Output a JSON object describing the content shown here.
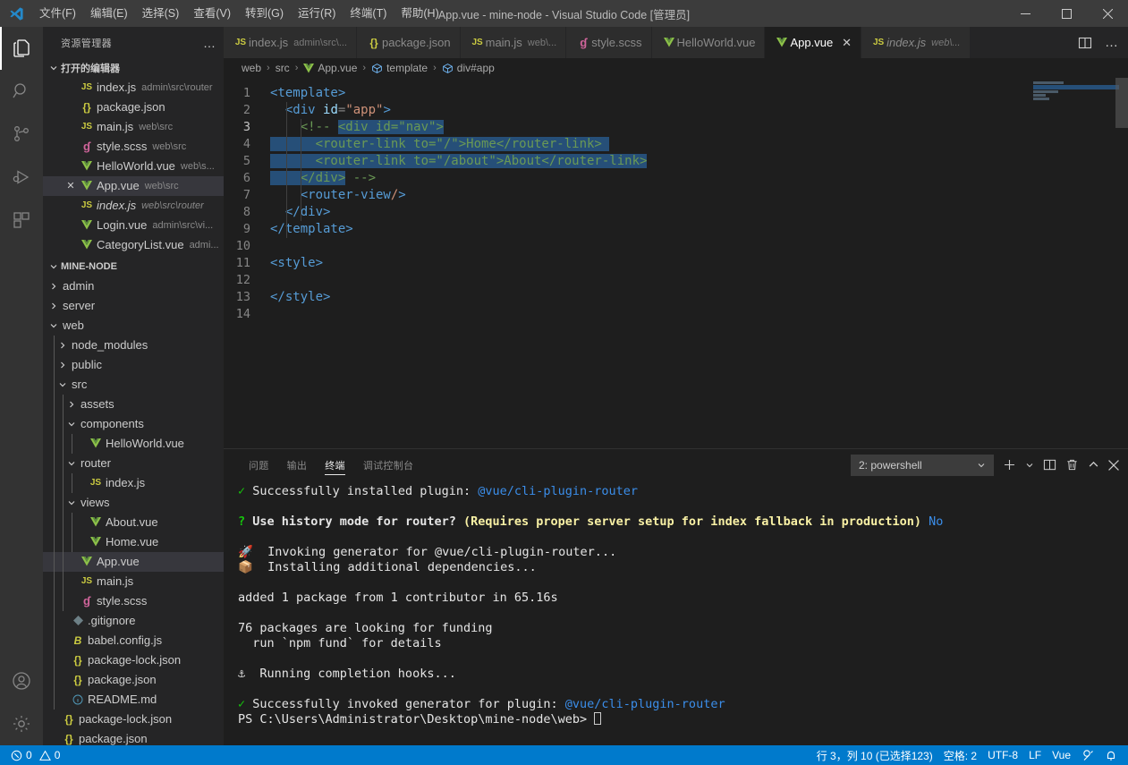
{
  "titlebar": {
    "title": "App.vue - mine-node - Visual Studio Code [管理员]",
    "menus": [
      "文件(F)",
      "编辑(E)",
      "选择(S)",
      "查看(V)",
      "转到(G)",
      "运行(R)",
      "终端(T)",
      "帮助(H)"
    ],
    "minimize": "minimize-icon",
    "maximize": "maximize-icon",
    "close": "close-icon"
  },
  "activitybar": {
    "items": [
      {
        "name": "explorer",
        "icon": "files-icon",
        "active": true
      },
      {
        "name": "search",
        "icon": "search-icon",
        "active": false
      },
      {
        "name": "source-control",
        "icon": "source-control-icon",
        "active": false
      },
      {
        "name": "run-debug",
        "icon": "run-debug-icon",
        "active": false
      },
      {
        "name": "extensions",
        "icon": "extensions-icon",
        "active": false
      }
    ],
    "bottom": [
      {
        "name": "accounts",
        "icon": "account-icon"
      },
      {
        "name": "manage",
        "icon": "gear-icon"
      }
    ]
  },
  "sidebar": {
    "title": "资源管理器",
    "more": "…",
    "open_editors": {
      "label": "打开的编辑器",
      "items": [
        {
          "icon": "js",
          "name": "index.js",
          "path": "admin\\src\\router",
          "active": false,
          "italic": false
        },
        {
          "icon": "json",
          "name": "package.json",
          "path": "",
          "active": false,
          "italic": false
        },
        {
          "icon": "js",
          "name": "main.js",
          "path": "web\\src",
          "active": false,
          "italic": false
        },
        {
          "icon": "scss",
          "name": "style.scss",
          "path": "web\\src",
          "active": false,
          "italic": false
        },
        {
          "icon": "vue",
          "name": "HelloWorld.vue",
          "path": "web\\s...",
          "active": false,
          "italic": false
        },
        {
          "icon": "vue",
          "name": "App.vue",
          "path": "web\\src",
          "active": true,
          "italic": false
        },
        {
          "icon": "js",
          "name": "index.js",
          "path": "web\\src\\router",
          "active": false,
          "italic": true
        },
        {
          "icon": "vue",
          "name": "Login.vue",
          "path": "admin\\src\\vi...",
          "active": false,
          "italic": false
        },
        {
          "icon": "vue",
          "name": "CategoryList.vue",
          "path": "admi...",
          "active": false,
          "italic": false
        }
      ]
    },
    "project": {
      "label": "MINE-NODE",
      "items": [
        {
          "depth": 1,
          "kind": "folder",
          "expanded": false,
          "name": "admin",
          "icon": ""
        },
        {
          "depth": 1,
          "kind": "folder",
          "expanded": false,
          "name": "server",
          "icon": ""
        },
        {
          "depth": 1,
          "kind": "folder",
          "expanded": true,
          "name": "web",
          "icon": ""
        },
        {
          "depth": 2,
          "kind": "folder",
          "expanded": false,
          "name": "node_modules",
          "icon": ""
        },
        {
          "depth": 2,
          "kind": "folder",
          "expanded": false,
          "name": "public",
          "icon": ""
        },
        {
          "depth": 2,
          "kind": "folder",
          "expanded": true,
          "name": "src",
          "icon": ""
        },
        {
          "depth": 3,
          "kind": "folder",
          "expanded": false,
          "name": "assets",
          "icon": ""
        },
        {
          "depth": 3,
          "kind": "folder",
          "expanded": true,
          "name": "components",
          "icon": ""
        },
        {
          "depth": 4,
          "kind": "file",
          "expanded": false,
          "name": "HelloWorld.vue",
          "icon": "vue"
        },
        {
          "depth": 3,
          "kind": "folder",
          "expanded": true,
          "name": "router",
          "icon": ""
        },
        {
          "depth": 4,
          "kind": "file",
          "expanded": false,
          "name": "index.js",
          "icon": "js"
        },
        {
          "depth": 3,
          "kind": "folder",
          "expanded": true,
          "name": "views",
          "icon": ""
        },
        {
          "depth": 4,
          "kind": "file",
          "expanded": false,
          "name": "About.vue",
          "icon": "vue"
        },
        {
          "depth": 4,
          "kind": "file",
          "expanded": false,
          "name": "Home.vue",
          "icon": "vue"
        },
        {
          "depth": 3,
          "kind": "file",
          "expanded": false,
          "name": "App.vue",
          "icon": "vue",
          "selected": true
        },
        {
          "depth": 3,
          "kind": "file",
          "expanded": false,
          "name": "main.js",
          "icon": "js"
        },
        {
          "depth": 3,
          "kind": "file",
          "expanded": false,
          "name": "style.scss",
          "icon": "scss"
        },
        {
          "depth": 2,
          "kind": "file",
          "expanded": false,
          "name": ".gitignore",
          "icon": "git"
        },
        {
          "depth": 2,
          "kind": "file",
          "expanded": false,
          "name": "babel.config.js",
          "icon": "babel"
        },
        {
          "depth": 2,
          "kind": "file",
          "expanded": false,
          "name": "package-lock.json",
          "icon": "json"
        },
        {
          "depth": 2,
          "kind": "file",
          "expanded": false,
          "name": "package.json",
          "icon": "json"
        },
        {
          "depth": 2,
          "kind": "file",
          "expanded": false,
          "name": "README.md",
          "icon": "md"
        },
        {
          "depth": 1,
          "kind": "file",
          "expanded": false,
          "name": "package-lock.json",
          "icon": "json"
        },
        {
          "depth": 1,
          "kind": "file",
          "expanded": false,
          "name": "package.json",
          "icon": "json"
        }
      ]
    }
  },
  "tabs": [
    {
      "icon": "js",
      "name": "index.js",
      "path": "admin\\src\\...",
      "active": false,
      "italic": false
    },
    {
      "icon": "json",
      "name": "package.json",
      "path": "",
      "active": false,
      "italic": false
    },
    {
      "icon": "js",
      "name": "main.js",
      "path": "web\\...",
      "active": false,
      "italic": false
    },
    {
      "icon": "scss",
      "name": "style.scss",
      "path": "",
      "active": false,
      "italic": false
    },
    {
      "icon": "vue",
      "name": "HelloWorld.vue",
      "path": "",
      "active": false,
      "italic": false
    },
    {
      "icon": "vue",
      "name": "App.vue",
      "path": "",
      "active": true,
      "italic": false,
      "close": "✕"
    },
    {
      "icon": "js",
      "name": "index.js",
      "path": "web\\...",
      "active": false,
      "italic": true
    }
  ],
  "tab_actions": {
    "split": "split-editor-icon",
    "more": "more-actions-icon"
  },
  "breadcrumb": [
    {
      "label": "web",
      "icon": ""
    },
    {
      "label": "src",
      "icon": ""
    },
    {
      "label": "App.vue",
      "icon": "vue"
    },
    {
      "label": "template",
      "icon": "symbol"
    },
    {
      "label": "div#app",
      "icon": "symbol"
    }
  ],
  "editor": {
    "language": "Vue",
    "lines": [
      {
        "n": "1",
        "segments": [
          {
            "t": "<template>",
            "c": "tk-tag"
          }
        ]
      },
      {
        "n": "2",
        "segments": [
          {
            "t": "  <div ",
            "c": "tk-tag"
          },
          {
            "t": "id",
            "c": "tk-attr"
          },
          {
            "t": "=",
            "c": "tk-punc"
          },
          {
            "t": "\"app\"",
            "c": "tk-str"
          },
          {
            "t": ">",
            "c": "tk-tag"
          }
        ]
      },
      {
        "n": "3",
        "segments": [
          {
            "t": "    <!-- ",
            "c": "tk-comment"
          },
          {
            "t": "<div id=\"nav\">",
            "c": "tk-comment sel"
          }
        ]
      },
      {
        "n": "4",
        "segments": [
          {
            "t": "      <router-link to=\"/\">Home</router-link> ",
            "c": "tk-comment sel"
          }
        ]
      },
      {
        "n": "5",
        "segments": [
          {
            "t": "      <router-link to=\"/about\">About</router-link>",
            "c": "tk-comment sel"
          }
        ]
      },
      {
        "n": "6",
        "segments": [
          {
            "t": "    </div>",
            "c": "tk-comment sel"
          },
          {
            "t": " -->",
            "c": "tk-comment"
          }
        ]
      },
      {
        "n": "7",
        "segments": [
          {
            "t": "    <router-view",
            "c": "tk-tag"
          },
          {
            "t": "/",
            "c": "tk-str"
          },
          {
            "t": ">",
            "c": "tk-tag"
          }
        ]
      },
      {
        "n": "8",
        "segments": [
          {
            "t": "  </div>",
            "c": "tk-tag"
          }
        ]
      },
      {
        "n": "9",
        "segments": [
          {
            "t": "</template>",
            "c": "tk-tag"
          }
        ]
      },
      {
        "n": "10",
        "segments": []
      },
      {
        "n": "11",
        "segments": [
          {
            "t": "<style>",
            "c": "tk-tag"
          }
        ]
      },
      {
        "n": "12",
        "segments": []
      },
      {
        "n": "13",
        "segments": [
          {
            "t": "</style>",
            "c": "tk-tag"
          }
        ]
      },
      {
        "n": "14",
        "segments": []
      }
    ]
  },
  "panel": {
    "tabs": [
      {
        "label": "问题",
        "active": false
      },
      {
        "label": "输出",
        "active": false
      },
      {
        "label": "终端",
        "active": true
      },
      {
        "label": "调试控制台",
        "active": false
      }
    ],
    "terminal_select": "2: powershell",
    "actions": [
      "new-terminal-icon",
      "chevron-down-icon",
      "split-terminal-icon",
      "trash-icon",
      "maximize-panel-icon",
      "close-panel-icon"
    ],
    "output": [
      [
        {
          "t": "✓ ",
          "c": "t-green"
        },
        {
          "t": "Successfully installed plugin: ",
          "c": "t-white"
        },
        {
          "t": "@vue/cli-plugin-router",
          "c": "t-cyan"
        }
      ],
      [],
      [
        {
          "t": "? ",
          "c": "t-green t-bold"
        },
        {
          "t": "Use history mode for router? ",
          "c": "t-white t-bold"
        },
        {
          "t": "(Requires proper server setup for index fallback in production) ",
          "c": "t-yellow t-bold"
        },
        {
          "t": "No",
          "c": "t-cyan"
        }
      ],
      [],
      [
        {
          "t": "🚀  Invoking generator for @vue/cli-plugin-router...",
          "c": "t-white"
        }
      ],
      [
        {
          "t": "📦  Installing additional dependencies...",
          "c": "t-white"
        }
      ],
      [],
      [
        {
          "t": "added 1 package from 1 contributor in 65.16s",
          "c": "t-white"
        }
      ],
      [],
      [
        {
          "t": "76 packages are looking for funding",
          "c": "t-white"
        }
      ],
      [
        {
          "t": "  run `npm fund` for details",
          "c": "t-white"
        }
      ],
      [],
      [
        {
          "t": "⚓  Running completion hooks...",
          "c": "t-white"
        }
      ],
      [],
      [
        {
          "t": "✓ ",
          "c": "t-green"
        },
        {
          "t": "Successfully invoked generator for plugin: ",
          "c": "t-white"
        },
        {
          "t": "@vue/cli-plugin-router",
          "c": "t-cyan"
        }
      ],
      [
        {
          "t": "PS C:\\Users\\Administrator\\Desktop\\mine-node\\web> ",
          "c": "t-white"
        }
      ]
    ]
  },
  "statusbar": {
    "errors": "0",
    "warnings": "0",
    "cursor": "行 3，列 10 (已选择123)",
    "spaces": "空格: 2",
    "encoding": "UTF-8",
    "eol": "LF",
    "language": "Vue",
    "feedback": "feedback-icon",
    "bell": "bell-icon",
    "accent": "#007acc"
  }
}
